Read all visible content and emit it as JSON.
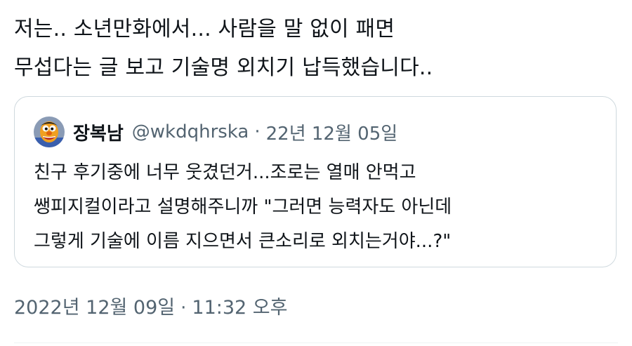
{
  "tweet": {
    "lines": [
      "저는.. 소년만화에서... 사람을 말 없이 패면",
      "무섭다는 글 보고 기술명 외치기 납득했습니다.."
    ]
  },
  "quote": {
    "display_name": "장복남",
    "handle": "@wkdqhrska",
    "separator": "·",
    "date": "22년 12월 05일",
    "avatar_icon": "character-avatar-icon",
    "lines": [
      "친구 후기중에 너무 웃겼던거...조로는 열매 안먹고",
      "쌩피지컬이라고 설명해주니까 \"그러면 능력자도 아닌데",
      "그렇게 기술에 이름 지으면서 큰소리로 외치는거야...?\""
    ]
  },
  "meta": {
    "date": "2022년 12월 09일",
    "separator": "·",
    "time": "11:32 오후"
  },
  "colors": {
    "text": "#0f1419",
    "secondary": "#536471",
    "border": "#cfd9de"
  }
}
